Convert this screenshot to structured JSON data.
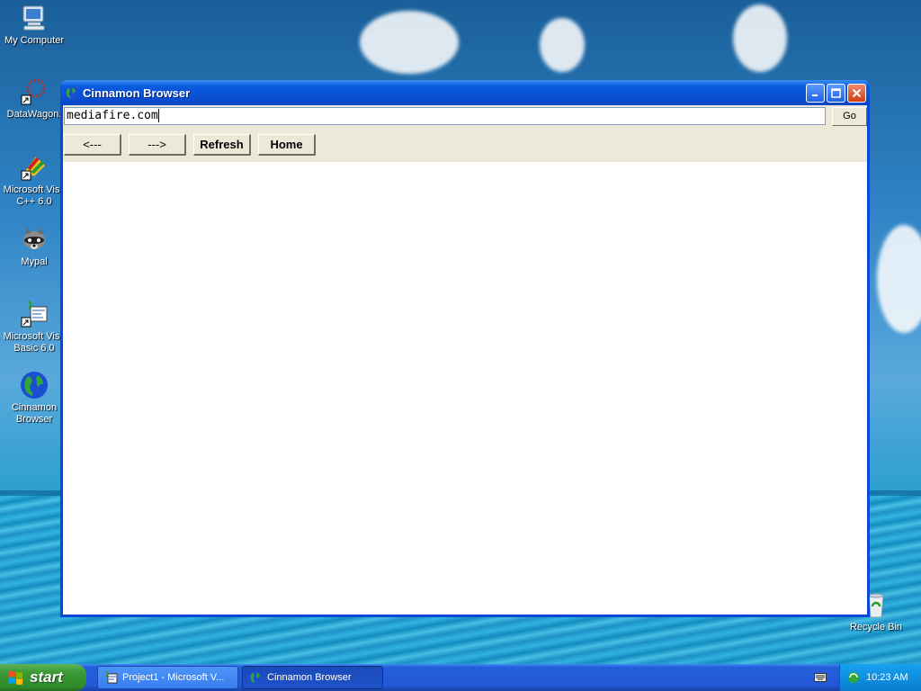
{
  "desktop": {
    "icons": [
      {
        "label": "My Computer",
        "icon": "computer-icon"
      },
      {
        "label": "DataWagon.",
        "icon": "datawagon-icon"
      },
      {
        "label": "Microsoft Visu C++ 6.0",
        "icon": "vc-icon"
      },
      {
        "label": "Mypal",
        "icon": "raccoon-icon"
      },
      {
        "label": "Microsoft Visu Basic 6.0",
        "icon": "vb-icon"
      },
      {
        "label": "Cinnamon Browser",
        "icon": "globe-icon"
      },
      {
        "label": "Recycle Bin",
        "icon": "recycle-bin-icon"
      }
    ]
  },
  "window": {
    "title": "Cinnamon Browser",
    "address_value": "mediafire.com",
    "go_label": "Go",
    "back_label": "<---",
    "forward_label": "--->",
    "refresh_label": "Refresh",
    "home_label": "Home"
  },
  "taskbar": {
    "start_label": "start",
    "tasks": [
      {
        "label": "Project1 - Microsoft V...",
        "active": false
      },
      {
        "label": "Cinnamon Browser",
        "active": true
      }
    ],
    "clock": "10:23 AM"
  },
  "colors": {
    "titlebar": "#0a5ae0",
    "taskbar": "#245edb",
    "start_green": "#3c9a37",
    "dialog_face": "#ece9d8"
  }
}
